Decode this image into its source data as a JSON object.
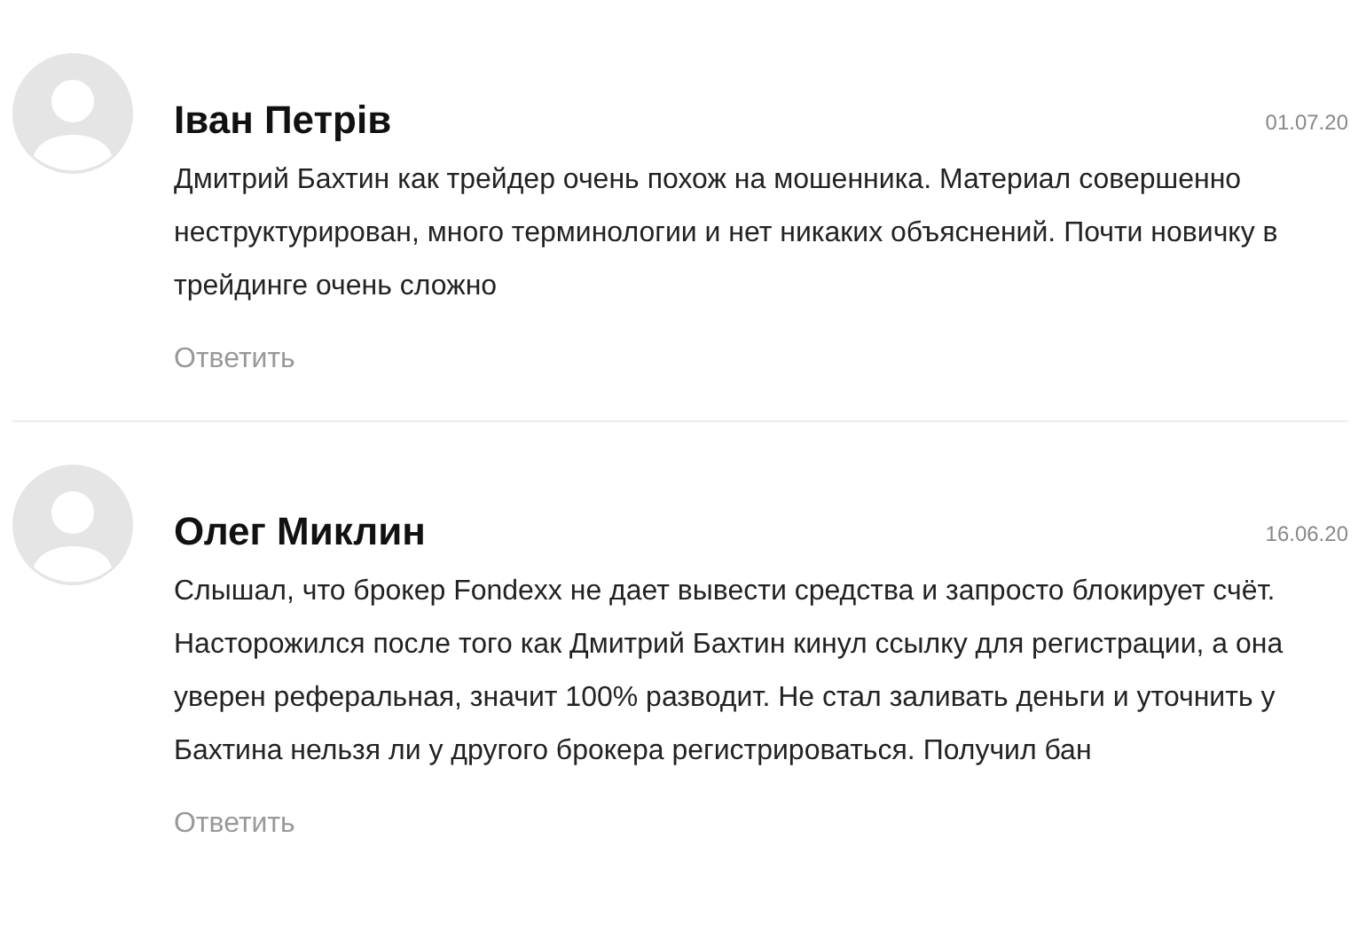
{
  "comments": [
    {
      "author": "Іван Петрів",
      "date": "01.07.20",
      "text": "Дмитрий Бахтин как трейдер очень похож на мошенника. Материал совершенно неструктурирован, много терминологии и нет никаких объяснений. Почти новичку в трейдинге очень сложно",
      "reply": "Ответить"
    },
    {
      "author": "Олег Миклин",
      "date": "16.06.20",
      "text": "Слышал, что брокер Fondexx не дает вывести средства и запросто блокирует счёт. Насторожился после того как Дмитрий Бахтин кинул ссылку для регистрации, а она уверен реферальная, значит 100% разводит. Не стал заливать деньги и уточнить у Бахтина нельзя ли у другого брокера регистрироваться. Получил бан",
      "reply": "Ответить"
    }
  ]
}
